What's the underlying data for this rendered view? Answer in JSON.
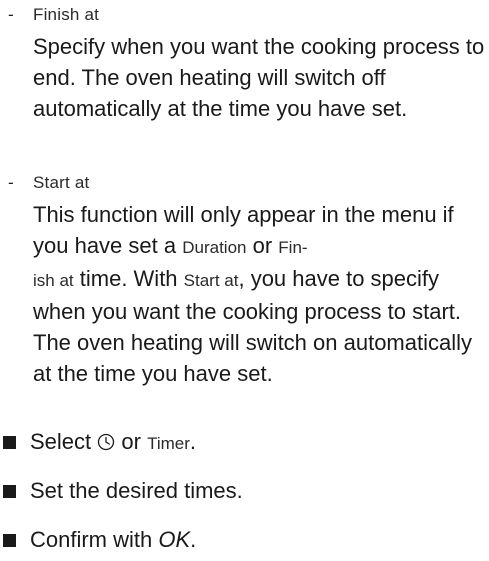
{
  "finish": {
    "dash": "-",
    "term": "Finish at",
    "description": "Specify when you want the cooking process to end. The oven heating will switch off automatically at the time you have set."
  },
  "start": {
    "dash": "-",
    "term": "Start at",
    "desc_part1": "This function will only appear in the menu if you have set a ",
    "duration": "Duration",
    "desc_or": " or ",
    "finish_hyph_1": "Fin-",
    "finish_hyph_2": "ish at",
    "desc_part2": " time. With ",
    "start_at": "Start at",
    "desc_part3": ", you have to specify when you want the cooking process to start. The oven heating will switch on automatically at the time you have set."
  },
  "steps": {
    "step1_prefix": "Select ",
    "step1_icon": "clock-icon",
    "step1_or": " or ",
    "step1_ui": "Timer",
    "step1_suffix": ".",
    "step2": "Set the desired times.",
    "step3_prefix": "Confirm with ",
    "step3_em": "OK",
    "step3_suffix": "."
  }
}
